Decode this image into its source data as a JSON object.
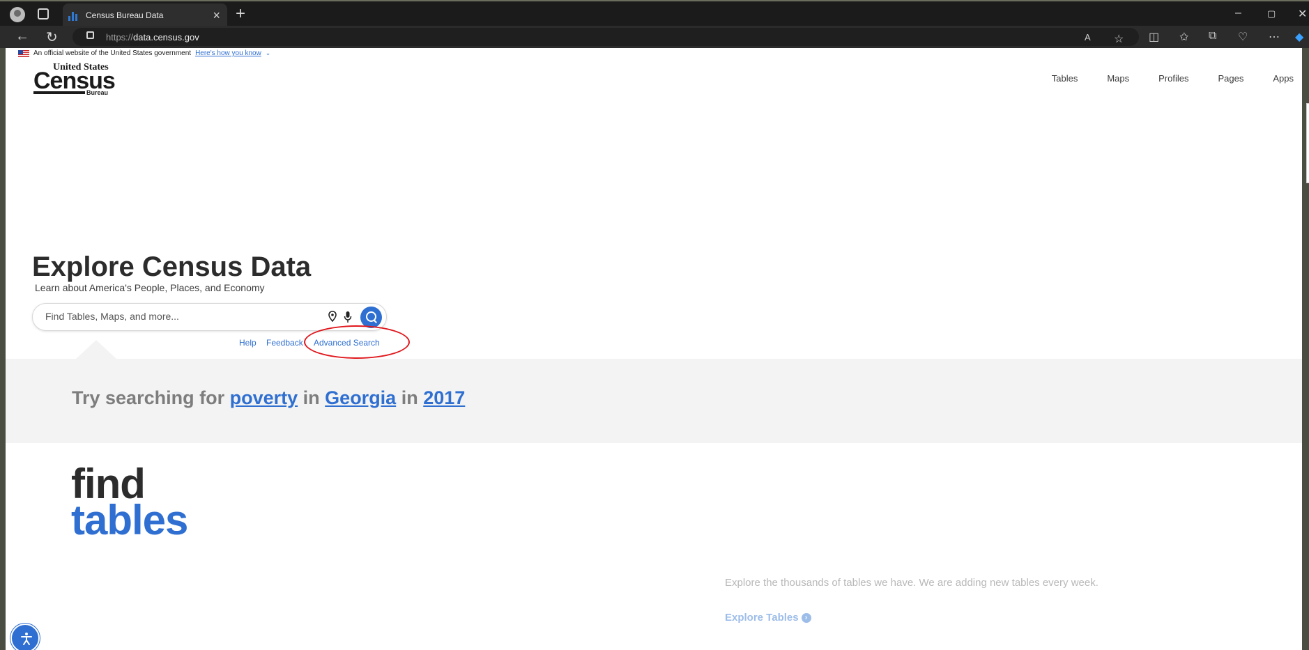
{
  "browser": {
    "tab_title": "Census Bureau Data",
    "tab_close": "×",
    "new_tab": "+",
    "url_prefix": "https://",
    "url_host": "data.census.gov",
    "window_controls": [
      "–",
      "▢",
      "✕"
    ],
    "toolbar_icons": [
      "read-aloud-icon",
      "favorite-star-icon",
      "split-screen-icon",
      "favorites-icon",
      "collections-icon",
      "browser-essentials-icon",
      "more-icon",
      "copilot-icon"
    ]
  },
  "gov_banner": {
    "text": "An official website of the United States government",
    "link": "Here's how you know",
    "chevron": "⌄"
  },
  "logo": {
    "top": "United States",
    "main": "Census",
    "bottom": "Bureau"
  },
  "nav": {
    "items": [
      "Tables",
      "Maps",
      "Profiles",
      "Pages",
      "Apps"
    ]
  },
  "hero": {
    "title": "Explore Census Data",
    "subtitle": "Learn about America's People, Places, and Economy"
  },
  "search": {
    "placeholder": "Find Tables, Maps, and more...",
    "links": [
      "Help",
      "Feedback",
      "Advanced Search"
    ]
  },
  "try": {
    "prefix": "Try searching for",
    "topic": "poverty",
    "in1": "in",
    "place": "Georgia",
    "in2": "in",
    "year": "2017"
  },
  "find_tables": {
    "word1": "find",
    "word2": "tables",
    "description": "Explore the thousands of tables we have. We are adding new tables every week.",
    "link": "Explore Tables"
  },
  "colors": {
    "accent": "#2f6fd1",
    "annotation": "#e0171c"
  }
}
